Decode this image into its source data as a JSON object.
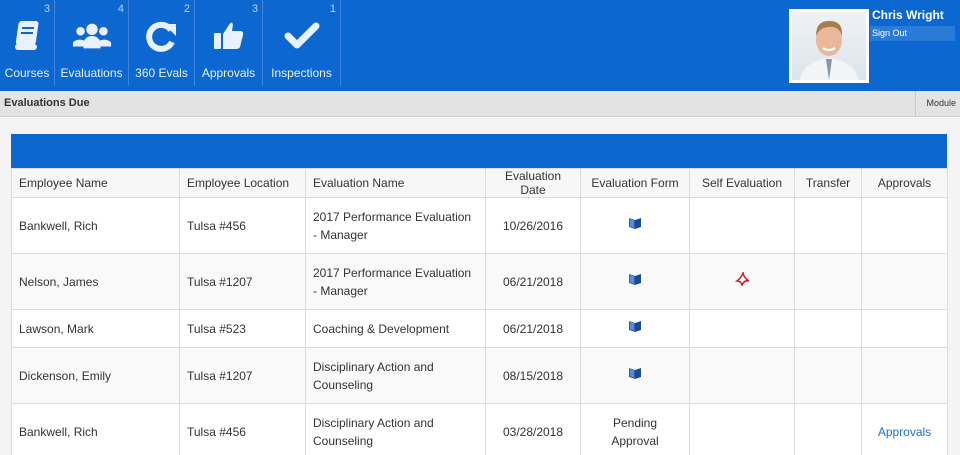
{
  "nav": [
    {
      "label": "Courses",
      "count": "3",
      "icon": "book-icon"
    },
    {
      "label": "Evaluations",
      "count": "4",
      "icon": "users-icon"
    },
    {
      "label": "360 Evals",
      "count": "2",
      "icon": "refresh-icon"
    },
    {
      "label": "Approvals",
      "count": "3",
      "icon": "thumbs-up-icon"
    },
    {
      "label": "Inspections",
      "count": "1",
      "icon": "checkmark-icon"
    }
  ],
  "user": {
    "name": "Chris Wright",
    "signout": "Sign Out"
  },
  "subheader": {
    "title": "Evaluations Due",
    "module": "Module"
  },
  "table": {
    "headers": [
      "Employee Name",
      "Employee Location",
      "Evaluation Name",
      "Evaluation Date",
      "Evaluation Form",
      "Self Evaluation",
      "Transfer",
      "Approvals"
    ],
    "rows": [
      {
        "name": "Bankwell, Rich",
        "location": "Tulsa #456",
        "eval_name": "2017 Performance Evaluation - Manager",
        "date": "10/26/2016",
        "form": "book-icon",
        "self": "",
        "transfer": "",
        "approvals": ""
      },
      {
        "name": "Nelson, James",
        "location": "Tulsa #1207",
        "eval_name": "2017 Performance Evaluation - Manager",
        "date": "06/21/2018",
        "form": "book-icon",
        "self": "pdf-icon",
        "transfer": "",
        "approvals": ""
      },
      {
        "name": "Lawson, Mark",
        "location": "Tulsa #523",
        "eval_name": "Coaching & Development",
        "date": "06/21/2018",
        "form": "book-icon",
        "self": "",
        "transfer": "",
        "approvals": ""
      },
      {
        "name": "Dickenson, Emily",
        "location": "Tulsa #1207",
        "eval_name": "Disciplinary Action and Counseling",
        "date": "08/15/2018",
        "form": "book-icon",
        "self": "",
        "transfer": "",
        "approvals": ""
      },
      {
        "name": "Bankwell, Rich",
        "location": "Tulsa #456",
        "eval_name": "Disciplinary Action and Counseling",
        "date": "03/28/2018",
        "form_text": "Pending Approval",
        "self": "",
        "transfer": "",
        "approvals": "Approvals"
      }
    ]
  },
  "colors": {
    "brand_blue": "#0d67d1",
    "link_blue": "#1f6fc9"
  }
}
